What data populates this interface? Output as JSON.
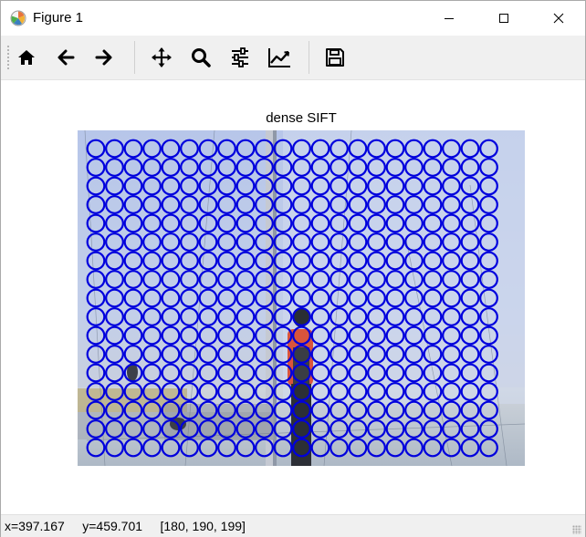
{
  "window": {
    "title": "Figure 1",
    "app_icon": "matplotlib-icon",
    "controls": [
      "minimize-icon",
      "maximize-icon",
      "close-icon"
    ]
  },
  "toolbar": {
    "buttons": [
      {
        "name": "home-button",
        "icon": "home-icon"
      },
      {
        "name": "back-button",
        "icon": "arrow-left-icon"
      },
      {
        "name": "forward-button",
        "icon": "arrow-right-icon"
      },
      {
        "name": "pan-button",
        "icon": "move-icon"
      },
      {
        "name": "zoom-button",
        "icon": "magnifier-icon"
      },
      {
        "name": "subplots-button",
        "icon": "sliders-icon"
      },
      {
        "name": "edit-axes-button",
        "icon": "line-chart-icon"
      },
      {
        "name": "save-button",
        "icon": "floppy-disk-icon"
      }
    ]
  },
  "figure": {
    "title": "dense SIFT",
    "circle_color": "#0000dd",
    "grid_columns": 22,
    "grid_rows": 17
  },
  "status": {
    "x": "x=397.167",
    "y": "y=459.701",
    "pixel": "[180, 190, 199]"
  }
}
